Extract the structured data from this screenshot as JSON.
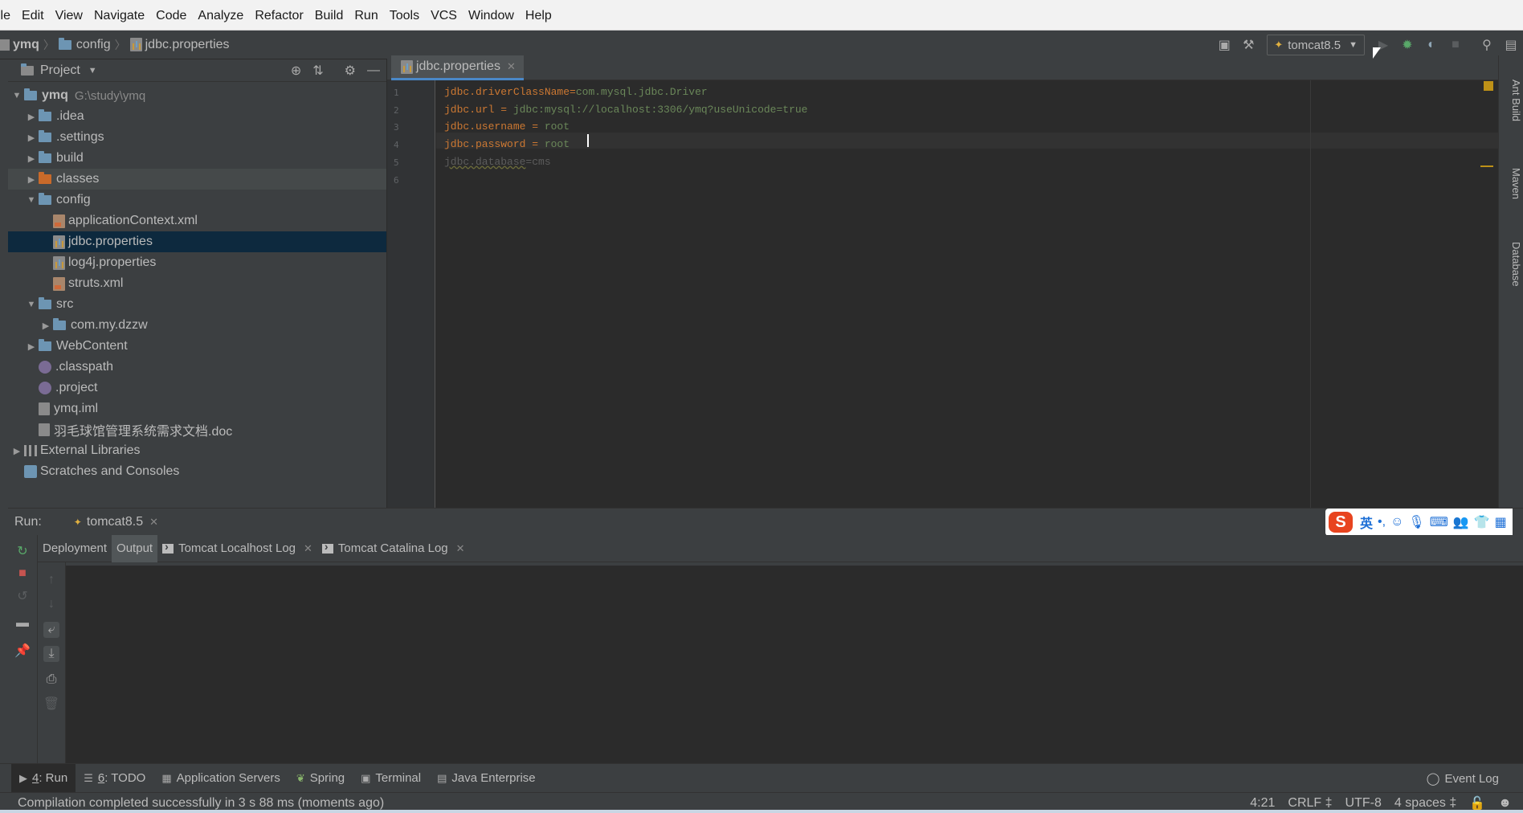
{
  "menu": [
    "ile",
    "Edit",
    "View",
    "Navigate",
    "Code",
    "Analyze",
    "Refactor",
    "Build",
    "Run",
    "Tools",
    "VCS",
    "Window",
    "Help"
  ],
  "breadcrumb": {
    "project": "ymq",
    "folder": "config",
    "file": "jdbc.properties"
  },
  "toolbar": {
    "run_config": "tomcat8.5"
  },
  "project_panel": {
    "title": "Project",
    "tree": [
      {
        "label": "ymq",
        "extra": "G:\\study\\ymq",
        "level": 0,
        "arrow": "down",
        "icon": "folder-icon"
      },
      {
        "label": ".idea",
        "level": 1,
        "arrow": "right",
        "icon": "folder-icon"
      },
      {
        "label": ".settings",
        "level": 1,
        "arrow": "right",
        "icon": "folder-icon"
      },
      {
        "label": "build",
        "level": 1,
        "arrow": "right",
        "icon": "folder-icon"
      },
      {
        "label": "classes",
        "level": 1,
        "arrow": "right",
        "icon": "excluded-folder-icon"
      },
      {
        "label": "config",
        "level": 1,
        "arrow": "down",
        "icon": "folder-icon"
      },
      {
        "label": "applicationContext.xml",
        "level": 2,
        "arrow": "",
        "icon": "xml-file-icon"
      },
      {
        "label": "jdbc.properties",
        "level": 2,
        "arrow": "",
        "icon": "properties-file-icon"
      },
      {
        "label": "log4j.properties",
        "level": 2,
        "arrow": "",
        "icon": "properties-file-icon"
      },
      {
        "label": "struts.xml",
        "level": 2,
        "arrow": "",
        "icon": "xml-file-icon"
      },
      {
        "label": "src",
        "level": 1,
        "arrow": "down",
        "icon": "folder-icon"
      },
      {
        "label": "com.my.dzzw",
        "level": 2,
        "arrow": "right",
        "icon": "package-icon"
      },
      {
        "label": "WebContent",
        "level": 1,
        "arrow": "right",
        "icon": "web-folder-icon"
      },
      {
        "label": ".classpath",
        "level": 1,
        "arrow": "",
        "icon": "classpath-file-icon"
      },
      {
        "label": ".project",
        "level": 1,
        "arrow": "",
        "icon": "classpath-file-icon"
      },
      {
        "label": "ymq.iml",
        "level": 1,
        "arrow": "",
        "icon": "iml-file-icon"
      },
      {
        "label": "羽毛球馆管理系统需求文档.doc",
        "level": 1,
        "arrow": "",
        "icon": "doc-file-icon"
      },
      {
        "label": "External Libraries",
        "level": 0,
        "arrow": "right",
        "icon": "library-icon"
      },
      {
        "label": "Scratches and Consoles",
        "level": 0,
        "arrow": "",
        "icon": "scratches-icon"
      }
    ]
  },
  "editor": {
    "tab": "jdbc.properties",
    "lines": [
      {
        "num": "1",
        "key": "jdbc.driverClassName",
        "sep": "=",
        "value": "com.mysql.jdbc.Driver"
      },
      {
        "num": "2",
        "key": "jdbc.url",
        "sep": " = ",
        "value": "jdbc:mysql://localhost:3306/ymq?useUnicode=true"
      },
      {
        "num": "3",
        "key": "jdbc.username",
        "sep": " = ",
        "value": "root"
      },
      {
        "num": "4",
        "key": "jdbc.password",
        "sep": " = ",
        "value": "root"
      },
      {
        "num": "5",
        "key": "jdbc.database",
        "sep": "=",
        "value": "cms"
      },
      {
        "num": "6",
        "key": "",
        "sep": "",
        "value": ""
      }
    ]
  },
  "right_stripe": [
    "Ant Build",
    "Maven",
    "Database"
  ],
  "run_panel": {
    "label": "Run:",
    "tab": "tomcat8.5",
    "sub_tabs": [
      "Deployment",
      "Output",
      "Tomcat Localhost Log",
      "Tomcat Catalina Log"
    ],
    "ime_label": "英"
  },
  "tool_windows": [
    {
      "key": "4",
      "label": ": Run"
    },
    {
      "key": "6",
      "label": ": TODO"
    },
    {
      "key": "",
      "label": "Application Servers"
    },
    {
      "key": "",
      "label": "Spring"
    },
    {
      "key": "",
      "label": "Terminal"
    },
    {
      "key": "",
      "label": "Java Enterprise"
    }
  ],
  "event_log": "Event Log",
  "status": {
    "message": "Compilation completed successfully in 3 s 88 ms (moments ago)",
    "position": "4:21",
    "line_sep": "CRLF ‡",
    "encoding": "UTF-8",
    "indent": "4 spaces ‡"
  }
}
